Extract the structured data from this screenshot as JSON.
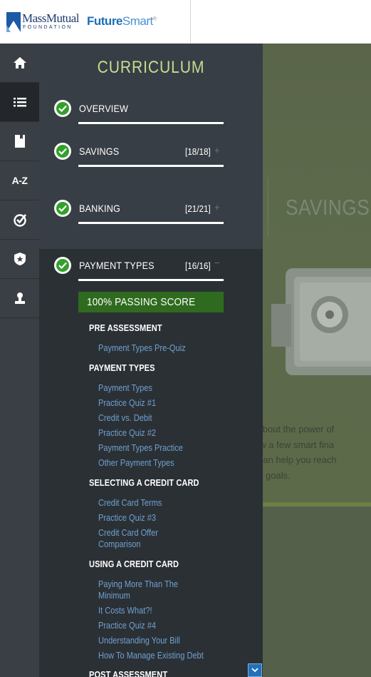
{
  "header": {
    "brand_primary": "MassMutual",
    "brand_secondary": "FOUNDATION",
    "product_bold": "Future",
    "product_light": "Smart",
    "trademark": "®"
  },
  "rail": {
    "items": [
      {
        "name": "home",
        "icon": "home-icon"
      },
      {
        "name": "curriculum",
        "icon": "list-icon",
        "active": true
      },
      {
        "name": "notebook",
        "icon": "notebook-icon"
      },
      {
        "name": "glossary",
        "label": "A-Z"
      },
      {
        "name": "quizzes",
        "icon": "check-badge-icon"
      },
      {
        "name": "badges",
        "icon": "star-shield-icon"
      },
      {
        "name": "profile",
        "icon": "user-icon"
      }
    ]
  },
  "curriculum": {
    "title": "CURRICULUM",
    "sections": [
      {
        "label": "OVERVIEW",
        "count": "",
        "toggle": ""
      },
      {
        "label": "SAVINGS",
        "count": "[18/18]",
        "toggle": "+"
      },
      {
        "label": "BANKING",
        "count": "[21/21]",
        "toggle": "+"
      },
      {
        "label": "PAYMENT TYPES",
        "count": "[16/16]",
        "toggle": "−"
      }
    ],
    "passing_score": "100% PASSING SCORE",
    "groups": [
      {
        "title": "PRE ASSESSMENT",
        "links": [
          "Payment Types Pre-Quiz"
        ]
      },
      {
        "title": "PAYMENT TYPES",
        "links": [
          "Payment Types",
          "Practice Quiz #1",
          "Credit vs. Debit",
          "Practice Quiz #2",
          "Payment Types Practice",
          "Other Payment Types"
        ]
      },
      {
        "title": "SELECTING A CREDIT CARD",
        "links": [
          "Credit Card Terms",
          "Practice Quiz #3",
          "Credit Card Offer",
          "Comparison"
        ]
      },
      {
        "title": "USING A CREDIT CARD",
        "links": [
          "Paying More Than The",
          "Minimum",
          "It Costs What?!",
          "Practice Quiz #4",
          "Understanding Your Bill",
          "How To Manage Existing Debt"
        ]
      },
      {
        "title": "POST ASSESSMENT",
        "links": []
      }
    ]
  },
  "background": {
    "title": "SAVINGS",
    "text_lines": [
      "arn about the power of",
      "d how a few smart fina",
      "bits can help you reach",
      "vings goals."
    ]
  },
  "colors": {
    "accent_green": "#33a02c",
    "title_green": "#c6dc91",
    "link_blue": "#6fa1cf",
    "pass_bar": "#2f6b1e"
  }
}
